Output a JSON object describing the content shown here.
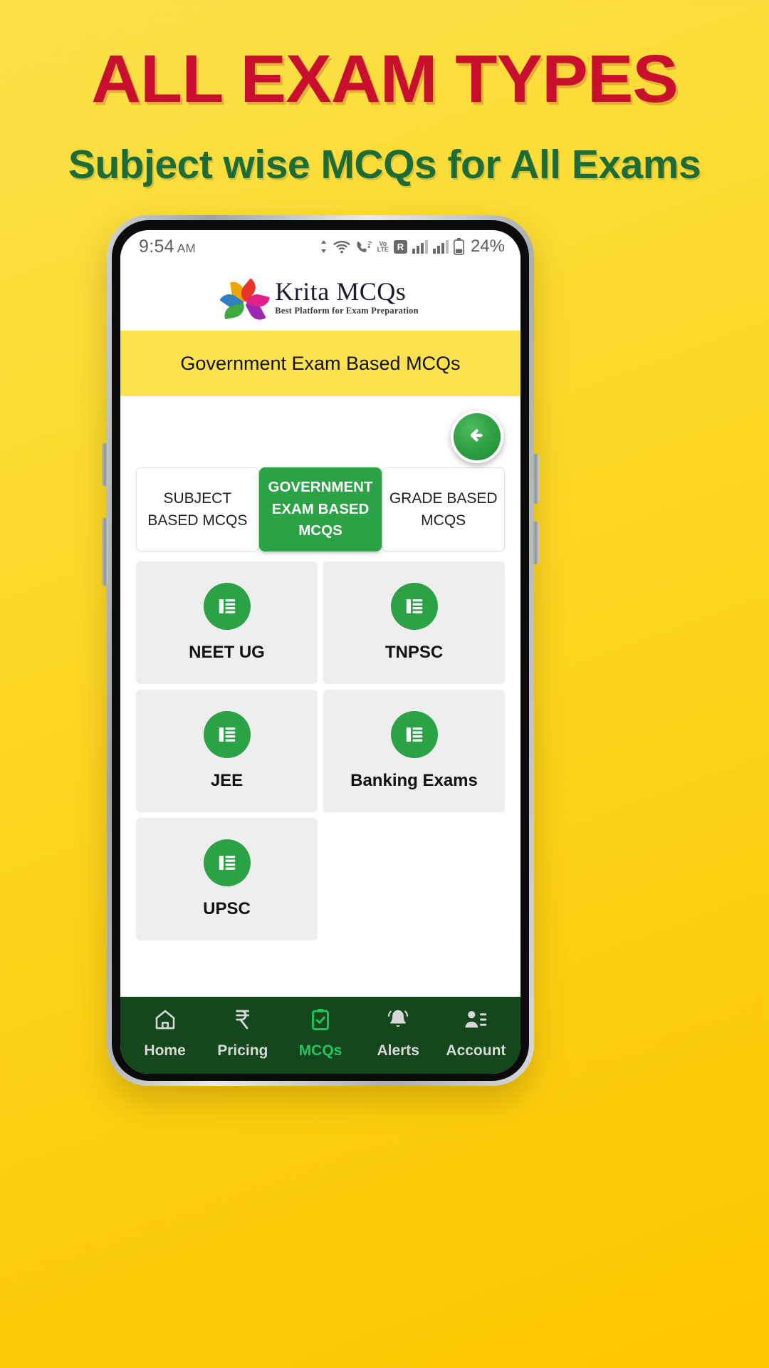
{
  "promo": {
    "title": "ALL EXAM TYPES",
    "subtitle": "Subject wise MCQs for All Exams",
    "title_color": "#c8102e",
    "subtitle_color": "#1d6b36",
    "background_color": "#fcd928"
  },
  "statusbar": {
    "time": "9:54",
    "ampm": "AM",
    "battery": "24%",
    "icons": [
      "data-transfer-icon",
      "wifi-icon",
      "call-wifi-icon",
      "volte-icon",
      "roaming-icon",
      "signal-sim1-icon",
      "signal-sim2-icon",
      "battery-icon"
    ],
    "volte_top": "Vo",
    "volte_bottom": "LTE",
    "roaming_letter": "R"
  },
  "app": {
    "logo_name": "Krita MCQs",
    "logo_tagline": "Best Platform for Exam Preparation",
    "page_title": "Government Exam Based MCQs",
    "title_bar_color": "#fce24f",
    "accent_green": "#2ba245",
    "back_button": "back-arrow-icon"
  },
  "tabs": [
    {
      "label": "SUBJECT BASED MCQS",
      "active": false
    },
    {
      "label": "GOVERNMENT EXAM BASED MCQS",
      "active": true
    },
    {
      "label": "GRADE BASED MCQS",
      "active": false
    }
  ],
  "exam_cards": [
    {
      "label": "NEET UG",
      "icon": "list-icon"
    },
    {
      "label": "TNPSC",
      "icon": "list-icon"
    },
    {
      "label": "JEE",
      "icon": "list-icon"
    },
    {
      "label": "Banking Exams",
      "icon": "list-icon"
    },
    {
      "label": "UPSC",
      "icon": "list-icon"
    }
  ],
  "bottom_nav": [
    {
      "label": "Home",
      "icon": "home-icon",
      "active": false
    },
    {
      "label": "Pricing",
      "icon": "rupee-icon",
      "active": false
    },
    {
      "label": "MCQs",
      "icon": "clipboard-check-icon",
      "active": true
    },
    {
      "label": "Alerts",
      "icon": "bell-icon",
      "active": false
    },
    {
      "label": "Account",
      "icon": "account-icon",
      "active": false
    }
  ]
}
